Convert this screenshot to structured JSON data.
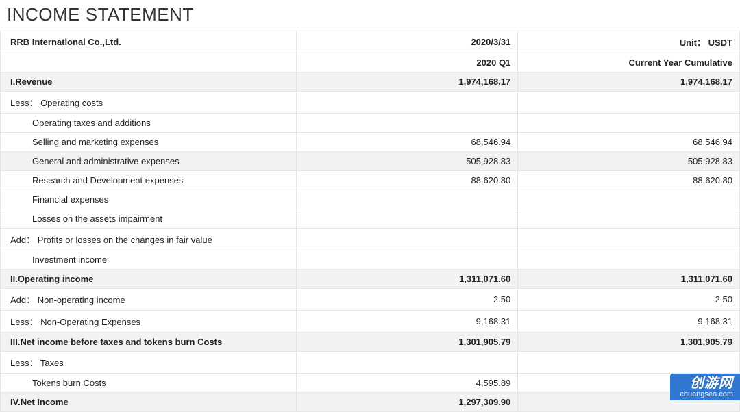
{
  "title": "INCOME STATEMENT",
  "header": {
    "company": "RRB International Co.,Ltd.",
    "period_end": "2020/3/31",
    "unit_label": "Unit： USDT",
    "col_q1": "2020 Q1",
    "col_cum": "Current Year Cumulative"
  },
  "rows": [
    {
      "label": "I.Revenue",
      "q1": "1,974,168.17",
      "cum": "1,974,168.17",
      "bold": true,
      "shade": true,
      "indent": 0
    },
    {
      "label": "Less： Operating costs",
      "q1": "",
      "cum": "",
      "indent": 0
    },
    {
      "label": "Operating taxes and additions",
      "q1": "",
      "cum": "",
      "indent": 2
    },
    {
      "label": "Selling and marketing expenses",
      "q1": "68,546.94",
      "cum": "68,546.94",
      "indent": 2
    },
    {
      "label": "General and administrative expenses",
      "q1": "505,928.83",
      "cum": "505,928.83",
      "indent": 2,
      "shade": true
    },
    {
      "label": "Research and Development expenses",
      "q1": "88,620.80",
      "cum": "88,620.80",
      "indent": 2
    },
    {
      "label": "Financial expenses",
      "q1": "",
      "cum": "",
      "indent": 2
    },
    {
      "label": "Losses on the assets impairment",
      "q1": "",
      "cum": "",
      "indent": 2
    },
    {
      "label": "Add： Profits or losses on the changes in fair value",
      "q1": "",
      "cum": "",
      "indent": 0
    },
    {
      "label": "Investment income",
      "q1": "",
      "cum": "",
      "indent": 2
    },
    {
      "label": "II.Operating income",
      "q1": "1,311,071.60",
      "cum": "1,311,071.60",
      "bold": true,
      "shade": true,
      "indent": 0
    },
    {
      "label": "Add：  Non-operating income",
      "q1": "2.50",
      "cum": "2.50",
      "indent": 0
    },
    {
      "label": "Less： Non-Operating Expenses",
      "q1": "9,168.31",
      "cum": "9,168.31",
      "indent": 0
    },
    {
      "label": "III.Net income before taxes and tokens burn Costs",
      "q1": "1,301,905.79",
      "cum": "1,301,905.79",
      "bold": true,
      "shade": true,
      "indent": 0
    },
    {
      "label": "Less： Taxes",
      "q1": "",
      "cum": "",
      "indent": 0
    },
    {
      "label": "Tokens burn Costs",
      "q1": "4,595.89",
      "cum": "",
      "indent": 2
    },
    {
      "label": "IV.Net Income",
      "q1": "1,297,309.90",
      "cum": "",
      "bold": true,
      "shade": true,
      "indent": 0
    }
  ],
  "watermark": {
    "cn": "创游网",
    "url": "chuangseo.com"
  },
  "chart_data": {
    "type": "table",
    "title": "INCOME STATEMENT",
    "company": "RRB International Co.,Ltd.",
    "period_end": "2020-03-31",
    "unit": "USDT",
    "columns": [
      "Line item",
      "2020 Q1",
      "Current Year Cumulative"
    ],
    "data": [
      [
        "I.Revenue",
        1974168.17,
        1974168.17
      ],
      [
        "Less: Operating costs",
        null,
        null
      ],
      [
        "Operating taxes and additions",
        null,
        null
      ],
      [
        "Selling and marketing expenses",
        68546.94,
        68546.94
      ],
      [
        "General and administrative expenses",
        505928.83,
        505928.83
      ],
      [
        "Research and Development expenses",
        88620.8,
        88620.8
      ],
      [
        "Financial expenses",
        null,
        null
      ],
      [
        "Losses on the assets impairment",
        null,
        null
      ],
      [
        "Add: Profits or losses on the changes in fair value",
        null,
        null
      ],
      [
        "Investment income",
        null,
        null
      ],
      [
        "II.Operating income",
        1311071.6,
        1311071.6
      ],
      [
        "Add: Non-operating income",
        2.5,
        2.5
      ],
      [
        "Less: Non-Operating Expenses",
        9168.31,
        9168.31
      ],
      [
        "III.Net income before taxes and tokens burn Costs",
        1301905.79,
        1301905.79
      ],
      [
        "Less: Taxes",
        null,
        null
      ],
      [
        "Tokens burn Costs",
        4595.89,
        null
      ],
      [
        "IV.Net Income",
        1297309.9,
        null
      ]
    ]
  }
}
